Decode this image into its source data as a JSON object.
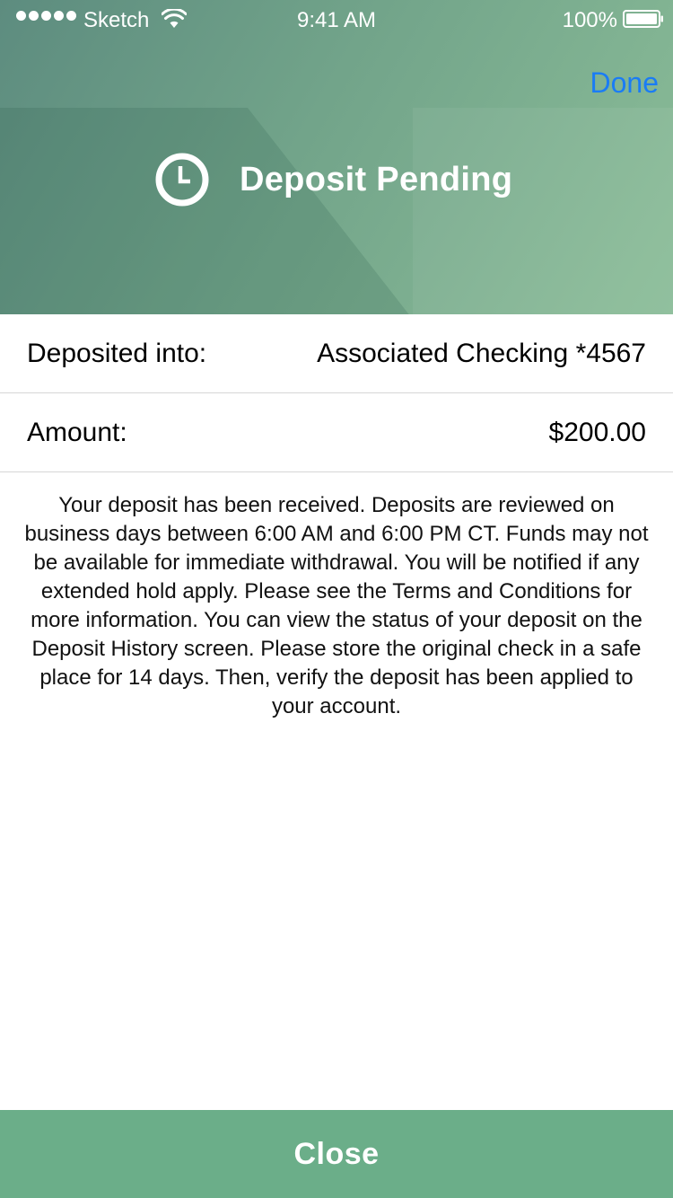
{
  "status_bar": {
    "carrier": "Sketch",
    "time": "9:41 AM",
    "battery_percent": "100%"
  },
  "header": {
    "done_label": "Done",
    "title": "Deposit Pending",
    "icon": "clock-icon"
  },
  "details": [
    {
      "label": "Deposited into:",
      "value": "Associated Checking *4567"
    },
    {
      "label": "Amount:",
      "value": "$200.00"
    }
  ],
  "message": "Your deposit has been received. Deposits are reviewed on business days between 6:00 AM and 6:00 PM CT. Funds may not be available for immediate withdrawal. You will be notified if any extended hold apply. Please see the Terms and Conditions for more information. You can view the status of your deposit on the Deposit History screen. Please store the original check in a safe place for 14 days. Then, verify the deposit has been applied to your account.",
  "footer": {
    "close_label": "Close"
  },
  "colors": {
    "header_gradient_start": "#5d8c7f",
    "header_gradient_end": "#8bbd98",
    "accent_link": "#1a7cf5",
    "close_button": "#6bae89"
  }
}
